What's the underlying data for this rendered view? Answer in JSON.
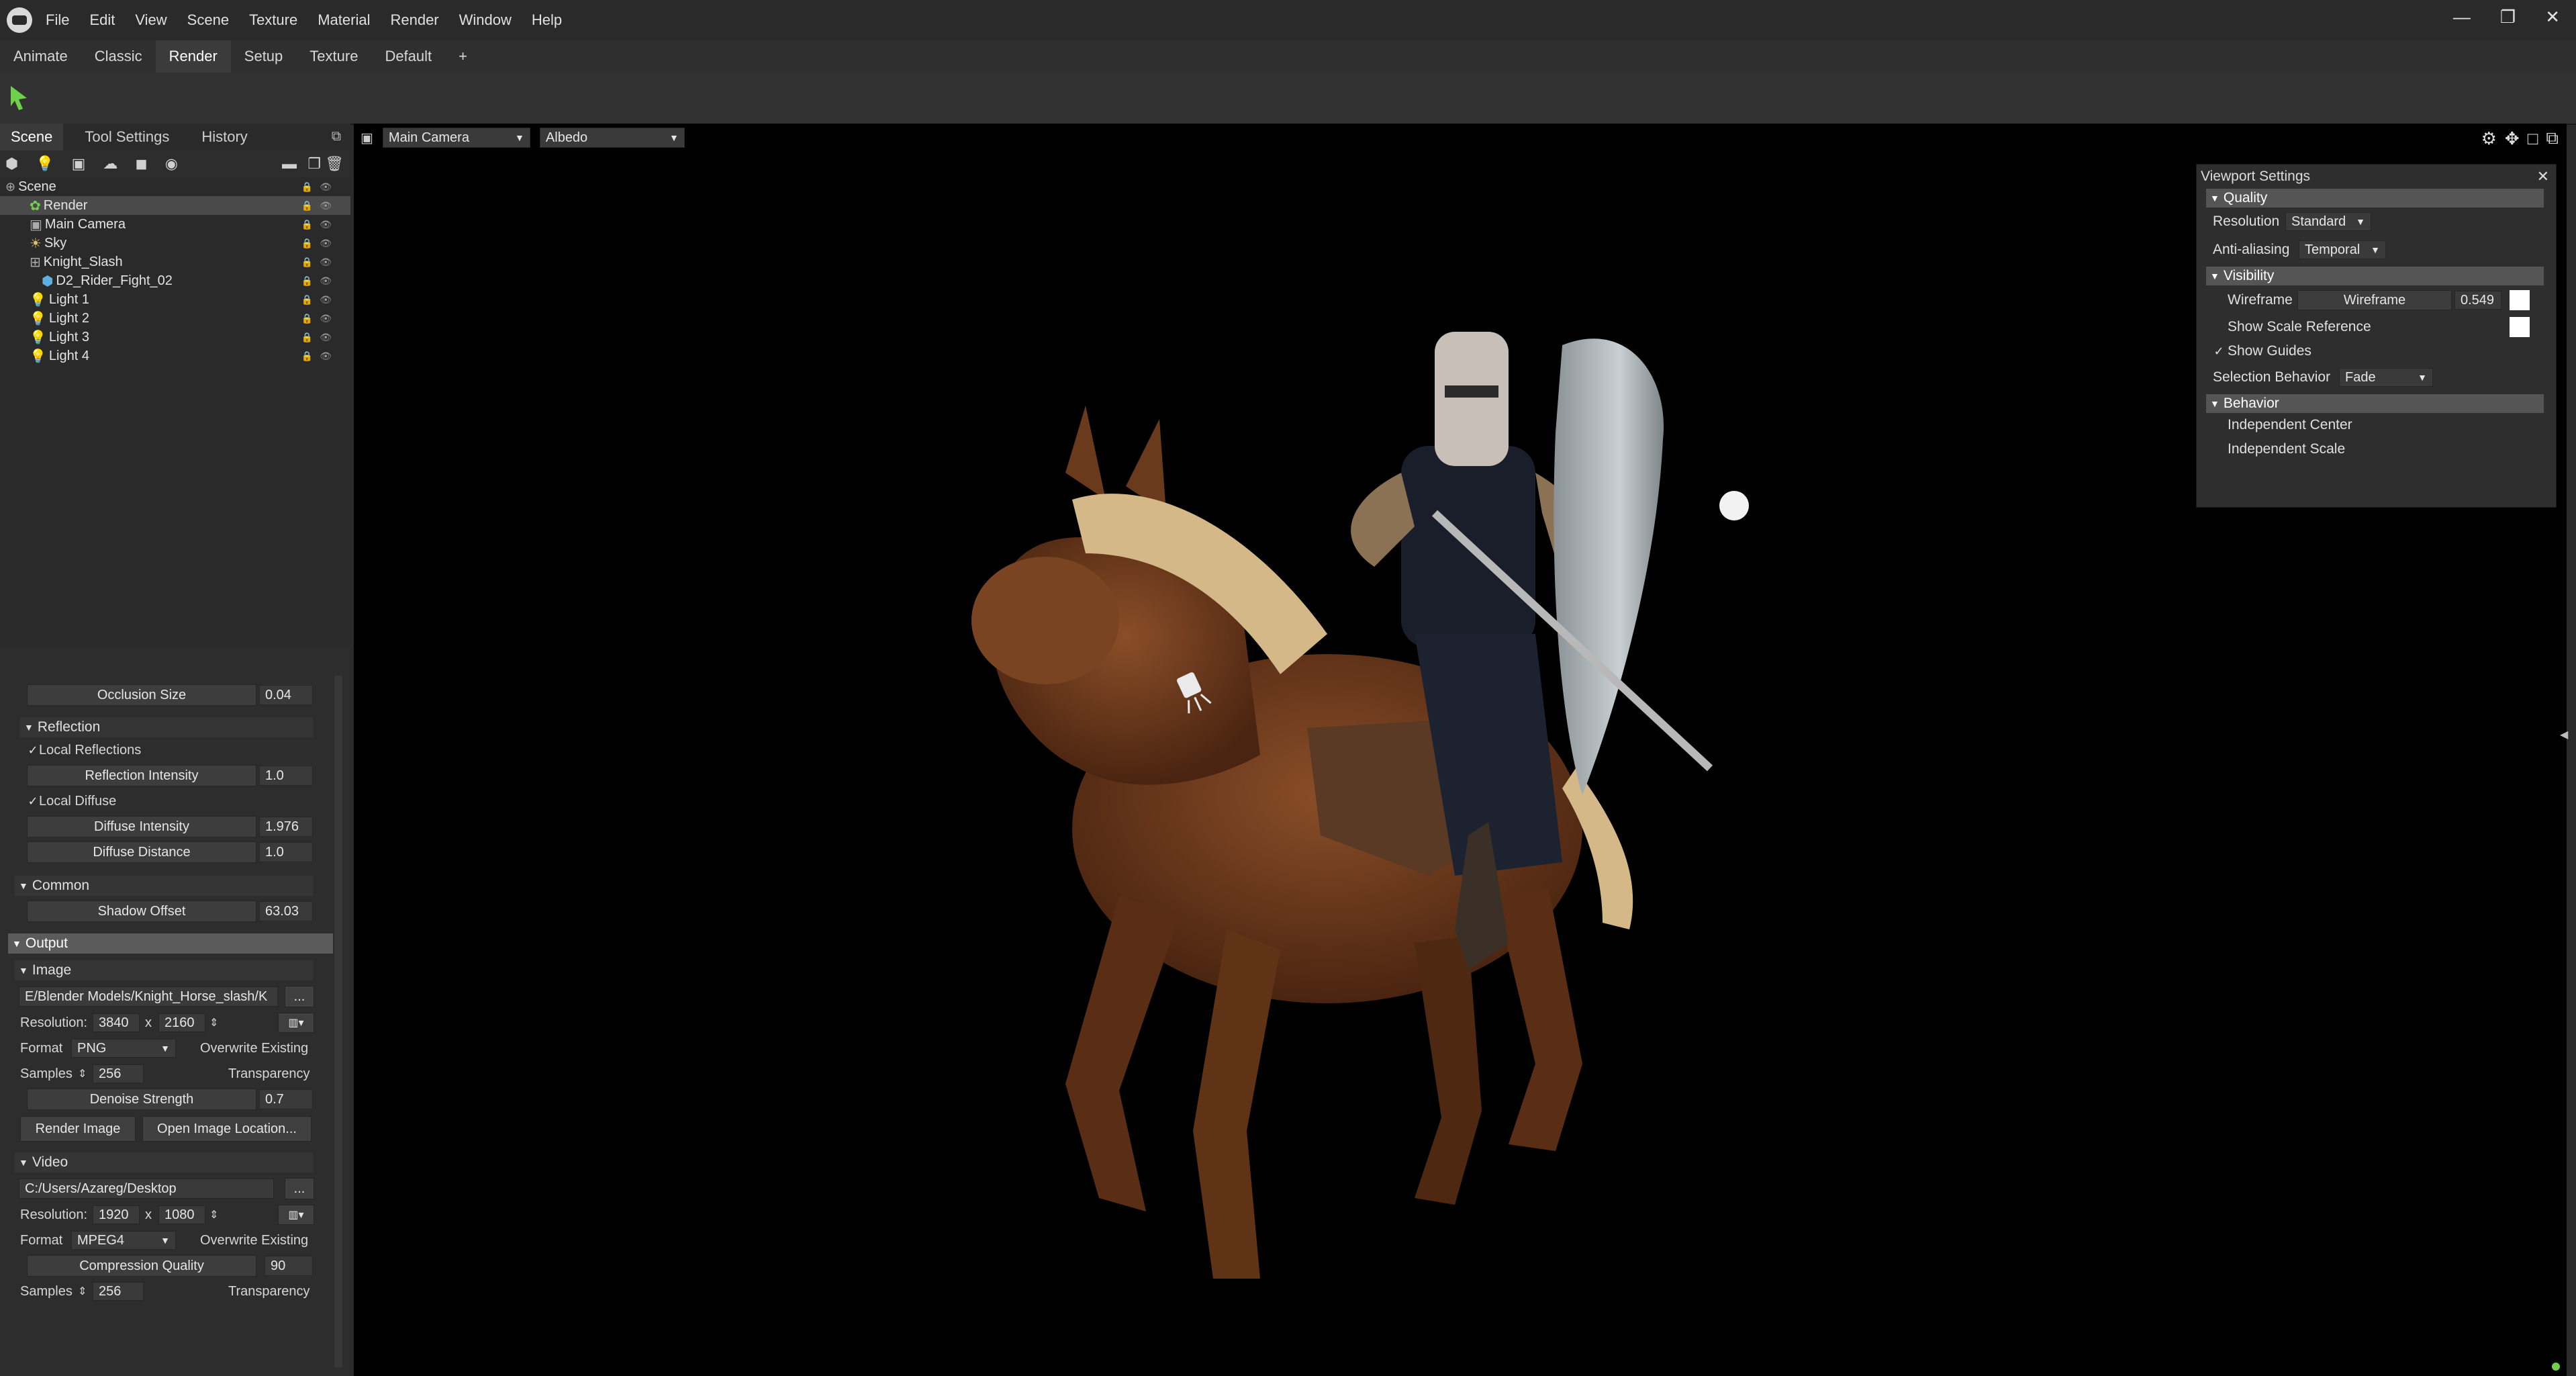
{
  "menu": {
    "items": [
      "File",
      "Edit",
      "View",
      "Scene",
      "Texture",
      "Material",
      "Render",
      "Window",
      "Help"
    ]
  },
  "window_controls": {
    "minimize": "—",
    "restore": "❐",
    "close": "✕"
  },
  "workspace_tabs": [
    "Animate",
    "Classic",
    "Render",
    "Setup",
    "Texture",
    "Default",
    "+"
  ],
  "panel_tabs": [
    "Scene",
    "Tool Settings",
    "History"
  ],
  "outliner": {
    "items": [
      {
        "label": "Scene",
        "indent": 0,
        "icon": "scene-icon"
      },
      {
        "label": "Render",
        "indent": 1,
        "icon": "render-icon",
        "selected": true
      },
      {
        "label": "Main Camera",
        "indent": 1,
        "icon": "camera-icon"
      },
      {
        "label": "Sky",
        "indent": 1,
        "icon": "sky-icon"
      },
      {
        "label": "Knight_Slash",
        "indent": 1,
        "icon": "object-icon"
      },
      {
        "label": "D2_Rider_Fight_02",
        "indent": 2,
        "icon": "mesh-icon"
      },
      {
        "label": "Light 1",
        "indent": 1,
        "icon": "light-icon"
      },
      {
        "label": "Light 2",
        "indent": 1,
        "icon": "light-icon"
      },
      {
        "label": "Light 3",
        "indent": 1,
        "icon": "light-icon"
      },
      {
        "label": "Light 4",
        "indent": 1,
        "icon": "light-icon"
      }
    ]
  },
  "props": {
    "occlusion_size_label": "Occlusion Size",
    "occlusion_size": "0.04",
    "reflection_section": "Reflection",
    "local_reflections": "Local Reflections",
    "reflection_intensity_label": "Reflection Intensity",
    "reflection_intensity": "1.0",
    "local_diffuse": "Local Diffuse",
    "diffuse_intensity_label": "Diffuse Intensity",
    "diffuse_intensity": "1.976",
    "diffuse_distance_label": "Diffuse Distance",
    "diffuse_distance": "1.0",
    "common_section": "Common",
    "shadow_offset_label": "Shadow Offset",
    "shadow_offset": "63.03",
    "output_section": "Output",
    "image_section": "Image",
    "image_path": "E/Blender Models/Knight_Horse_slash/K",
    "browse": "...",
    "resolution_label": "Resolution:",
    "image_res_w": "3840",
    "image_res_h": "2160",
    "times": "x",
    "format_label": "Format",
    "image_format": "PNG",
    "overwrite_existing": "Overwrite Existing",
    "samples_label": "Samples",
    "image_samples": "256",
    "transparency": "Transparency",
    "denoise_label": "Denoise Strength",
    "denoise": "0.7",
    "render_image": "Render Image",
    "open_image_location": "Open Image Location...",
    "video_section": "Video",
    "video_path": "C:/Users/Azareg/Desktop",
    "video_res_w": "1920",
    "video_res_h": "1080",
    "video_format": "MPEG4",
    "compression_label": "Compression Quality",
    "compression": "90",
    "video_samples": "256"
  },
  "viewport": {
    "camera": "Main Camera",
    "channel": "Albedo"
  },
  "viewport_settings": {
    "title": "Viewport Settings",
    "quality": "Quality",
    "resolution_label": "Resolution",
    "resolution": "Standard",
    "antialiasing_label": "Anti-aliasing",
    "antialiasing": "Temporal",
    "visibility": "Visibility",
    "wireframe_label": "Wireframe",
    "wireframe_slider": "Wireframe",
    "wireframe_value": "0.549",
    "show_scale_reference": "Show Scale Reference",
    "show_guides": "Show Guides",
    "selection_behavior_label": "Selection Behavior",
    "selection_behavior": "Fade",
    "behavior": "Behavior",
    "independent_center": "Independent Center",
    "independent_scale": "Independent Scale"
  },
  "colors": {
    "accent_green": "#6fd14a",
    "selection": "#4a4a4a",
    "section_output": "#5b5b5b"
  }
}
